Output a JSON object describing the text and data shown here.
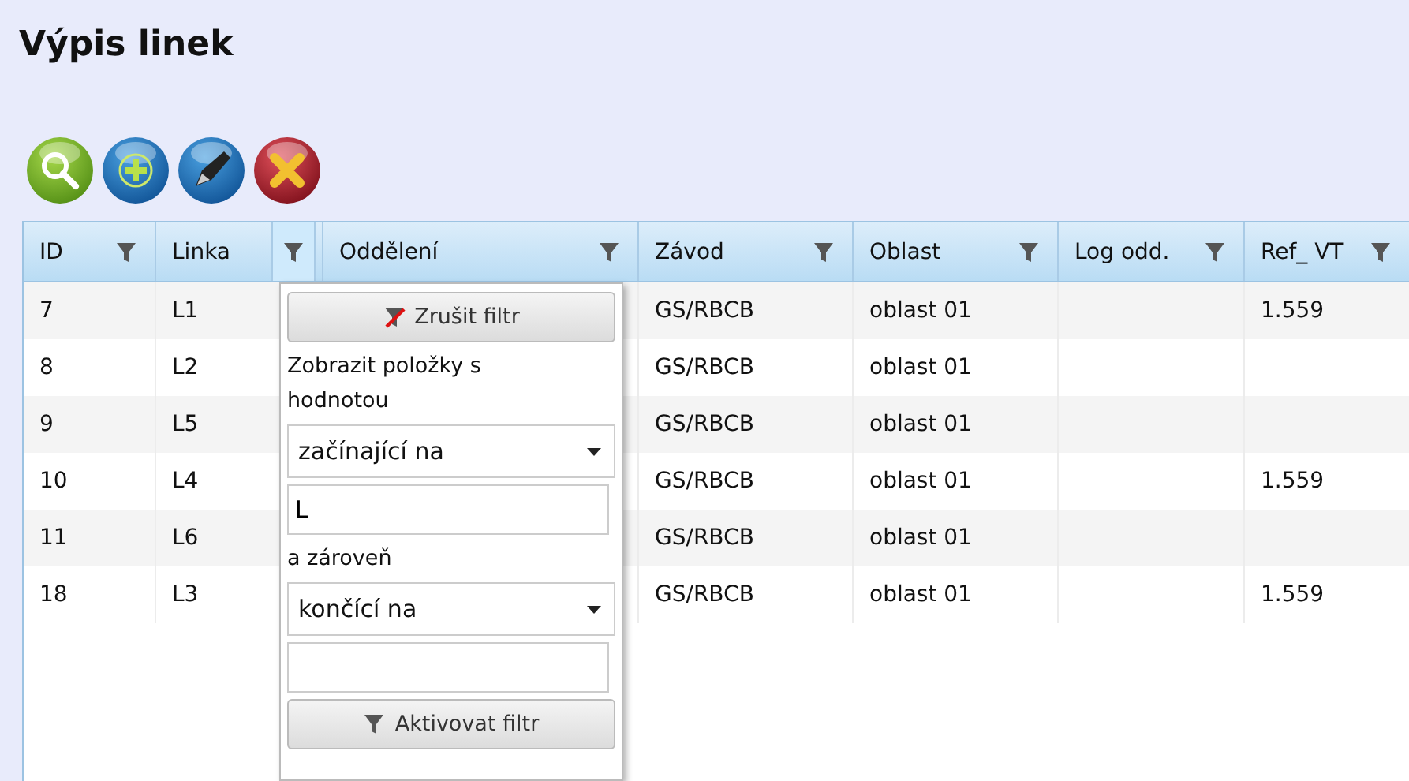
{
  "page": {
    "title": "Výpis linek"
  },
  "toolbar": [
    {
      "kind": "search"
    },
    {
      "kind": "add"
    },
    {
      "kind": "edit"
    },
    {
      "kind": "delete"
    }
  ],
  "table": {
    "columns": [
      {
        "label": "ID",
        "filter_active": false
      },
      {
        "label": "Linka",
        "filter_active": true
      },
      {
        "label": "Oddělení",
        "filter_active": false
      },
      {
        "label": "Závod",
        "filter_active": false
      },
      {
        "label": "Oblast",
        "filter_active": false
      },
      {
        "label": "Log odd.",
        "filter_active": false
      },
      {
        "label": "Ref_ VT",
        "filter_active": false
      }
    ],
    "rows": [
      {
        "id": "7",
        "linka": "L1",
        "zavod": "GS/RBCB",
        "oblast": "oblast 01",
        "ref_vt": "1.559"
      },
      {
        "id": "8",
        "linka": "L2",
        "zavod": "GS/RBCB",
        "oblast": "oblast 01"
      },
      {
        "id": "9",
        "linka": "L5",
        "zavod": "GS/RBCB",
        "oblast": "oblast 01"
      },
      {
        "id": "10",
        "linka": "L4",
        "zavod": "GS/RBCB",
        "oblast": "oblast 01",
        "ref_vt": "1.559"
      },
      {
        "id": "11",
        "linka": "L6",
        "zavod": "GS/RBCB",
        "oblast": "oblast 01"
      },
      {
        "id": "18",
        "linka": "L3",
        "zavod": "GS/RBCB",
        "oblast": "oblast 01",
        "ref_vt": "1.559"
      }
    ]
  },
  "filter_popup": {
    "clear_button": "Zrušit filtr",
    "label": "Zobrazit položky s hodnotou",
    "condition_1": {
      "operator": "začínající na",
      "value": "L"
    },
    "joiner": "a zároveň",
    "condition_2": {
      "operator": "končící na"
    },
    "apply_button": "Aktivovat filtr"
  }
}
